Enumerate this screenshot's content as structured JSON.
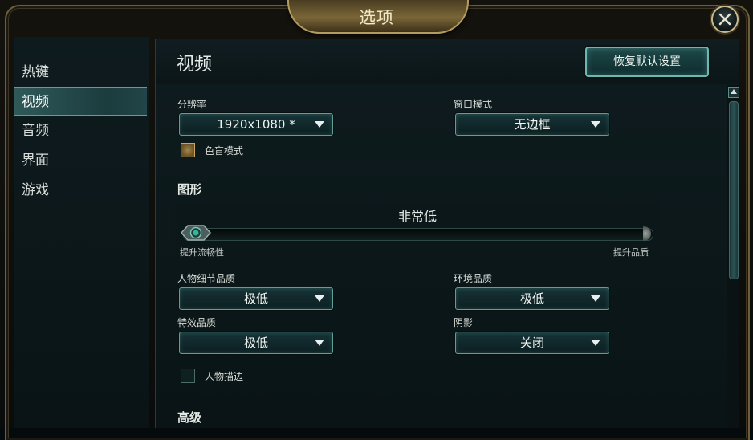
{
  "window": {
    "title": "选项",
    "close_icon": "close-icon"
  },
  "sidebar": {
    "items": [
      {
        "label": "热键",
        "active": false
      },
      {
        "label": "视频",
        "active": true
      },
      {
        "label": "音频",
        "active": false
      },
      {
        "label": "界面",
        "active": false
      },
      {
        "label": "游戏",
        "active": false
      }
    ]
  },
  "main": {
    "title": "视频",
    "reset_label": "恢复默认设置",
    "resolution": {
      "label": "分辨率",
      "value": "1920x1080 *"
    },
    "window_mode": {
      "label": "窗口模式",
      "value": "无边框"
    },
    "colorblind": {
      "label": "色盲模式",
      "checked": true
    },
    "graphics": {
      "section_label": "图形",
      "level_label": "非常低",
      "min_label": "提升流畅性",
      "max_label": "提升品质",
      "level": 0
    },
    "character_quality": {
      "label": "人物细节品质",
      "value": "极低"
    },
    "environment_quality": {
      "label": "环境品质",
      "value": "极低"
    },
    "effects_quality": {
      "label": "特效品质",
      "value": "极低"
    },
    "shadows": {
      "label": "阴影",
      "value": "关闭"
    },
    "outline": {
      "label": "人物描边",
      "checked": false
    },
    "advanced_label": "高级"
  },
  "colors": {
    "accent": "#6cb7b0",
    "gold": "#b39c5f",
    "panel": "#0b1719"
  }
}
